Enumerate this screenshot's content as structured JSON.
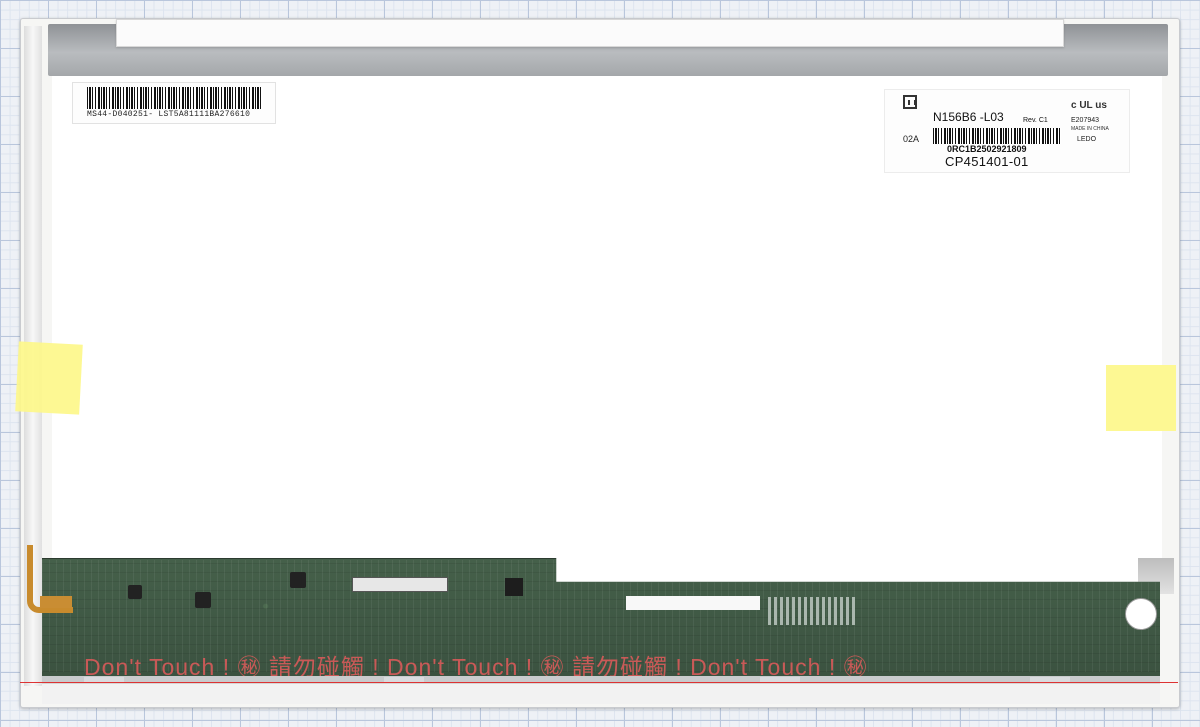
{
  "panel": {
    "left_label": {
      "text": "MS44-D040251- LST5A81111BA276610"
    },
    "right_label": {
      "model": "N156B6  -L03",
      "revision": "Rev. C1",
      "ul_mark": "c UL us",
      "ul_file": "E207943",
      "origin": "MADE IN CHINA",
      "country": "LEDO",
      "code": "02A",
      "serial": "0RC1B2502921809",
      "part_number": "CP451401-01"
    },
    "pcb": {
      "warning": "Don't Touch !  ㊙  請勿碰觸 !  Don't Touch !  ㊙  請勿碰觸 !  Don't Touch ! ㊙"
    },
    "colors": {
      "tape": "#fdf78a",
      "pcb": "#3b5240",
      "warning_text": "#e25b5b"
    }
  }
}
